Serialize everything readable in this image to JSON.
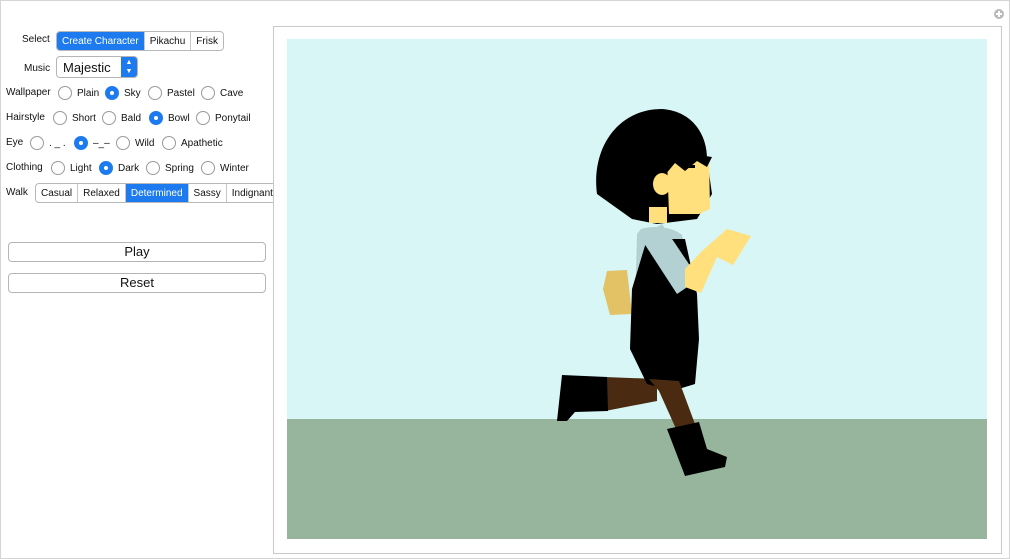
{
  "controls": {
    "select": {
      "label": "Select",
      "options": [
        "Create Character",
        "Pikachu",
        "Frisk"
      ],
      "selected": "Create Character"
    },
    "music": {
      "label": "Music",
      "value": "Majestic"
    },
    "wallpaper": {
      "label": "Wallpaper",
      "options": [
        "Plain",
        "Sky",
        "Pastel",
        "Cave"
      ],
      "selected": "Sky"
    },
    "hairstyle": {
      "label": "Hairstyle",
      "options": [
        "Short",
        "Bald",
        "Bowl",
        "Ponytail"
      ],
      "selected": "Bowl"
    },
    "eye": {
      "label": "Eye",
      "options": [
        ". _ .",
        "–_–",
        "Wild",
        "Apathetic"
      ],
      "selected": "–_–"
    },
    "clothing": {
      "label": "Clothing",
      "options": [
        "Light",
        "Dark",
        "Spring",
        "Winter"
      ],
      "selected": "Dark"
    },
    "walk": {
      "label": "Walk",
      "options": [
        "Casual",
        "Relaxed",
        "Determined",
        "Sassy",
        "Indignant"
      ],
      "selected": "Determined"
    }
  },
  "buttons": {
    "play": "Play",
    "reset": "Reset"
  },
  "colors": {
    "accent": "#1d7bef",
    "sky": "#d9f6f7",
    "ground": "#97b59c",
    "skin": "#ffe07c",
    "skin_back": "#e2c264",
    "hair": "#000000",
    "shirt": "#b3d1d3",
    "vest": "#000000",
    "pants": "#4a2b12",
    "boots": "#000000"
  }
}
